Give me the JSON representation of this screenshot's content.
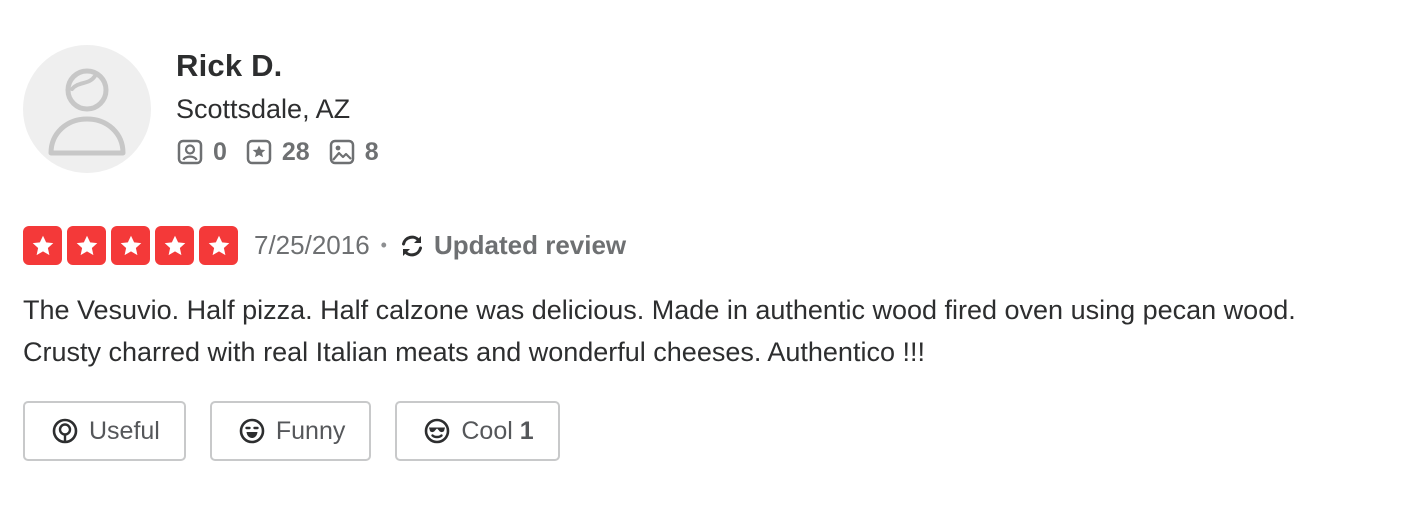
{
  "user": {
    "name": "Rick D.",
    "location": "Scottsdale, AZ",
    "stats": {
      "friends": "0",
      "reviews": "28",
      "photos": "8"
    }
  },
  "review": {
    "rating": 5,
    "rating_max": 5,
    "date": "7/25/2016",
    "separator": "•",
    "updated_label": "Updated review",
    "text": "The Vesuvio. Half pizza. Half calzone was delicious. Made in authentic wood fired oven using pecan wood. Crusty charred with real Italian meats and wonderful cheeses. Authentico !!!"
  },
  "reactions": {
    "useful_label": "Useful",
    "funny_label": "Funny",
    "cool_label": "Cool",
    "cool_count": "1"
  },
  "colors": {
    "star": "#f43939",
    "text": "#2d2e2f",
    "muted": "#6e7072",
    "border": "#c8c9ca"
  }
}
